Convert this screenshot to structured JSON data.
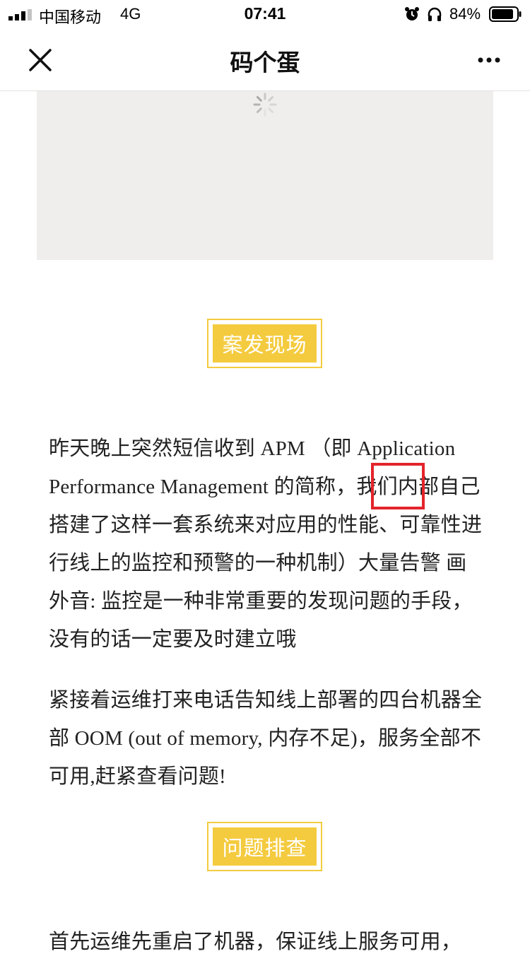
{
  "status_bar": {
    "carrier": "中国移动",
    "network": "4G",
    "time": "07:41",
    "battery": "84%"
  },
  "nav": {
    "title": "码个蛋"
  },
  "article": {
    "heading_1": "案发现场",
    "paragraph_1": "昨天晚上突然短信收到 APM （即 Application Performance Management 的简称，我们内部自己搭建了这样一套系统来对应用的性能、可靠性进行线上的监控和预警的一种机制）大量告警 画外音: 监控是一种非常重要的发现问题的手段，没有的话一定要及时建立哦",
    "paragraph_2": "紧接着运维打来电话告知线上部署的四台机器全部 OOM (out of memory, 内存不足)，服务全部不可用,赶紧查看问题!",
    "heading_2": "问题排查",
    "paragraph_3": "首先运维先重启了机器，保证线上服务可用，"
  },
  "colors": {
    "accent_yellow": "#f4cb3f",
    "highlight_red": "#e3242b",
    "placeholder_gray": "#efeeec"
  },
  "icons": {
    "close": "close-icon",
    "more": "more-icon",
    "spinner": "loading-spinner-icon",
    "alarm": "alarm-icon",
    "headphones": "headphones-icon",
    "battery": "battery-icon",
    "signal": "signal-icon"
  }
}
